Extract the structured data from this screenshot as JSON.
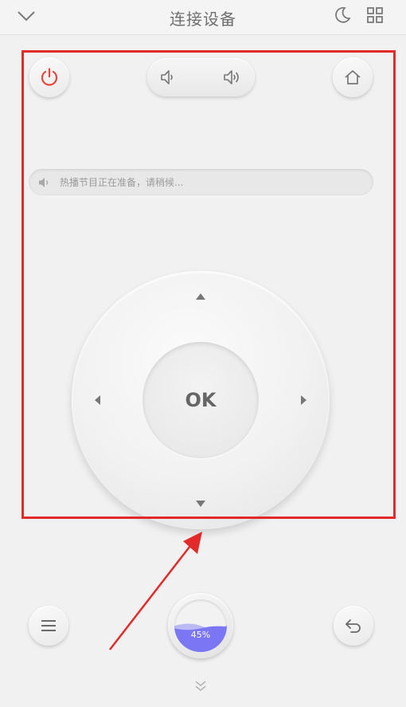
{
  "header": {
    "title": "连接设备",
    "collapse_icon": "chevron-down-icon",
    "night_mode_icon": "moon-icon",
    "apps_icon": "grid-icon"
  },
  "controls": {
    "power_icon": "power-icon",
    "home_icon": "home-icon",
    "volume_down_icon": "volume-down-icon",
    "volume_up_icon": "volume-up-icon",
    "menu_icon": "menu-icon",
    "back_icon": "back-icon"
  },
  "notice": {
    "icon": "speaker-icon",
    "text": "热播节目正在准备，请稍候..."
  },
  "dpad": {
    "ok_label": "OK"
  },
  "center_gauge": {
    "label": "45%",
    "fill": 0.45
  },
  "footer": {
    "expand_icon": "double-chevron-down-icon"
  },
  "colors": {
    "accent_red": "#e32a2a",
    "power_red": "#e8443a",
    "gauge_fill": "#7b76f4",
    "background": "#f1f1f1"
  }
}
